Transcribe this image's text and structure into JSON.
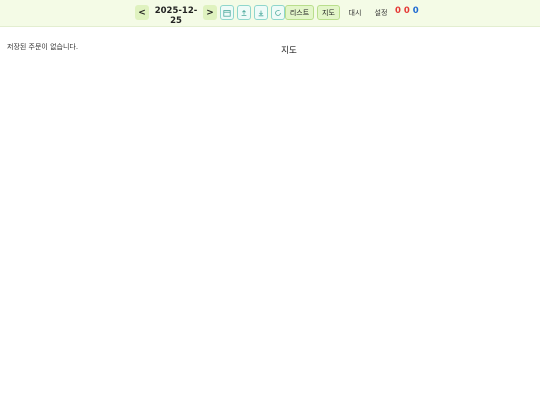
{
  "toolbar": {
    "prev_label": "<",
    "date": "2025-12-25",
    "next_label": ">",
    "icons": [
      "calendar-icon",
      "upload-icon",
      "download-icon",
      "refresh-icon"
    ],
    "list_label": "리스트",
    "map_label": "지도",
    "standby_label": "대시",
    "settings_label": "설정",
    "counts": [
      "0",
      "0",
      "0"
    ],
    "colors": {
      "count1": "#e53935",
      "count2": "#e53935",
      "count3": "#1e6ad2"
    }
  },
  "main": {
    "empty_message": "저장된 주문이 없습니다.",
    "map_heading": "지도"
  }
}
